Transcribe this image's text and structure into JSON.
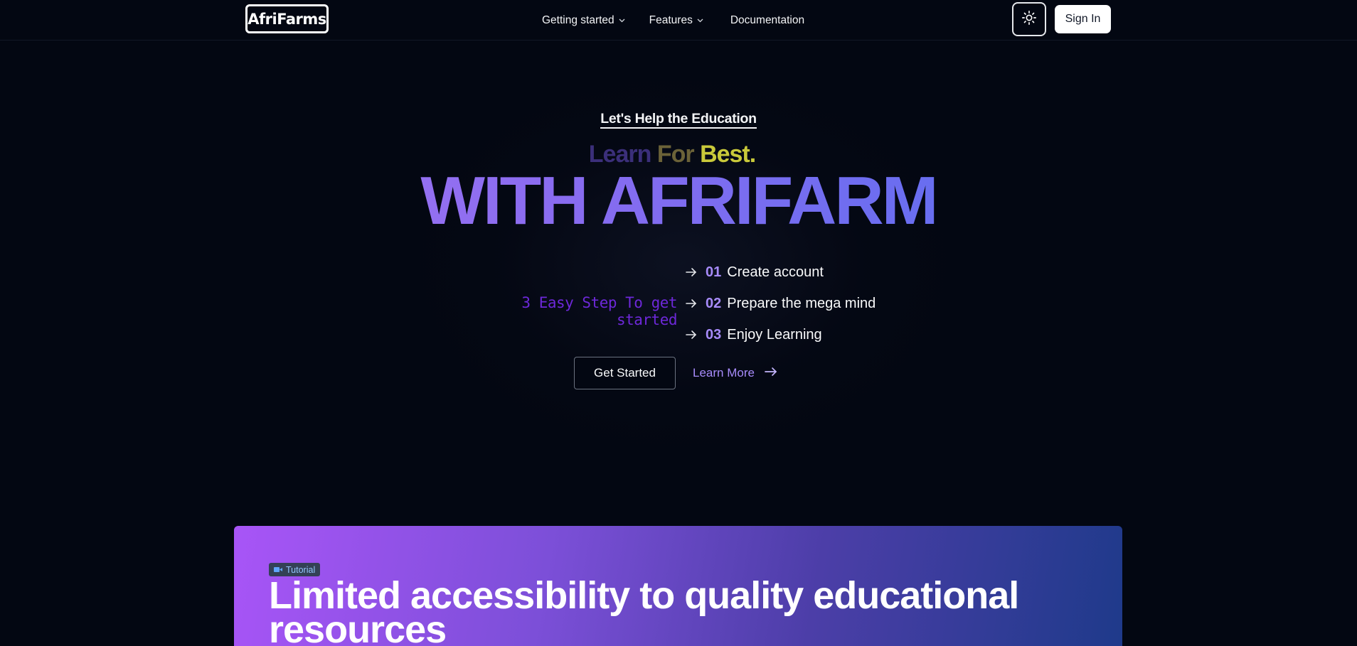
{
  "navbar": {
    "logo": "AfriFarms",
    "links": [
      {
        "label": "Getting started",
        "has_dropdown": true
      },
      {
        "label": "Features",
        "has_dropdown": true
      },
      {
        "label": "Documentation",
        "has_dropdown": false
      }
    ],
    "theme_icon": "sun-icon",
    "sign_in": "Sign In"
  },
  "hero": {
    "eyebrow": "Let's Help the Education",
    "subhead": {
      "w1": "Learn",
      "w2": "For",
      "w3": "Best."
    },
    "headline": "WITH AFRIFARM",
    "steps_label": "3 Easy Step To get started",
    "steps": [
      {
        "num": "01",
        "text": "Create account"
      },
      {
        "num": "02",
        "text": "Prepare the mega mind"
      },
      {
        "num": "03",
        "text": "Enjoy Learning"
      }
    ],
    "cta_primary": "Get Started",
    "cta_secondary": "Learn More"
  },
  "card": {
    "badge": "Tutorial",
    "badge_icon": "video-camera-icon",
    "title": "Limited accessibility to quality educational resources"
  },
  "colors": {
    "background": "#030712",
    "accent_purple": "#a78bfa",
    "steps_label": "#6d28d9",
    "card_gradient_start": "#a855f7",
    "card_gradient_end": "#1e3a8a"
  }
}
